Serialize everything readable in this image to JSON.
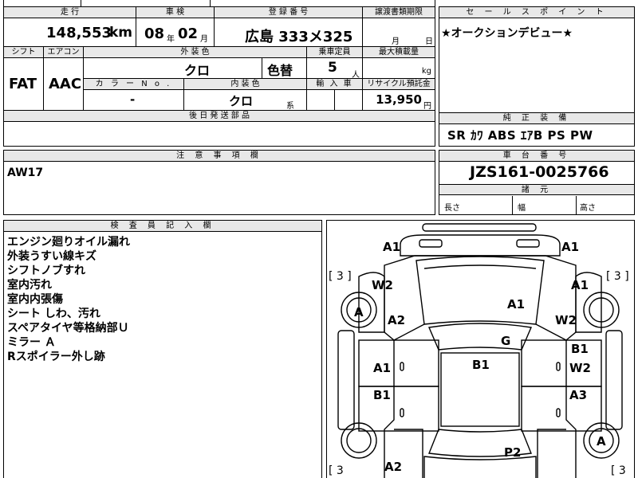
{
  "top": {
    "partial_header": "",
    "headers": {
      "mileage": "走 行",
      "inspection": "車 検",
      "registration": "登 録 番 号",
      "transfer_deadline": "譲渡書類期限"
    },
    "mileage": "148,553",
    "mileage_unit": "km",
    "inspection_year": "08",
    "inspection_year_unit": "年",
    "inspection_month": "02",
    "inspection_month_unit": "月",
    "registration": "広島 333メ325",
    "transfer_month_unit": "月",
    "transfer_day_unit": "日"
  },
  "row2": {
    "headers": {
      "shift": "シフト",
      "aircon": "エアコン",
      "exterior": "外 装 色",
      "capacity": "乗車定員",
      "max_load": "最大積載量",
      "color_no": "カ ラ ー N o .",
      "interior": "内 装 色",
      "import": "輸 入 車",
      "recycle": "リサイクル預託金"
    },
    "shift": "FAT",
    "aircon": "AAC",
    "exterior_color": "クロ",
    "color_change": "色替",
    "capacity": "5",
    "capacity_unit": "人",
    "max_load_unit": "kg",
    "color_no": "-",
    "interior_color": "クロ",
    "interior_suffix": "系",
    "recycle": "13,950",
    "recycle_unit": "円",
    "later_parts_header": "後 日 発 送 部 品"
  },
  "sales": {
    "header": "セ ー ル ス ポ イ ン ト",
    "text": "★オークションデビュー★"
  },
  "equipment": {
    "header": "純 正 装 備",
    "text": "SR ｶﾜ ABS ｴｱB PS PW"
  },
  "notes": {
    "header": "注 意 事 項 欄",
    "text": "AW17"
  },
  "chassis": {
    "header": "車 台 番 号",
    "number": "JZS161-0025766",
    "dims_header": "諸 元",
    "length": "長さ",
    "width": "幅",
    "height": "高さ"
  },
  "inspector": {
    "header": "検 査 員 記 入 欄",
    "lines": [
      "エンジン廻りオイル漏れ",
      "外装うすい線キズ",
      "シフトノブすれ",
      "室内汚れ",
      "室内内張傷",
      "シート しわ、汚れ",
      "スペアタイヤ等格納部Ｕ",
      "ミラー Ａ",
      "Rスポイラー外し跡"
    ]
  },
  "diagram": {
    "tire_left_top": "[ 3 ]",
    "tire_right_top": "[ 3 ]",
    "tire_left_bottom": "[ 3",
    "tire_right_bottom": "[ 3",
    "marks": {
      "front_left": "A1",
      "front_right": "A1",
      "fender_left": "W2",
      "fender_right": "A1",
      "wheel_left": "A",
      "wheel_left_rear": "A",
      "pillar_left": "A2",
      "pillar_right": "W2",
      "hood": "A1",
      "roof_front": "G",
      "door_fr_top": "B1",
      "door_fr_bot": "W2",
      "door_fl": "A1",
      "roof": "B1",
      "door_rl": "B1",
      "door_rr": "A3",
      "trunk": "P2",
      "rear_left": "A2"
    }
  }
}
